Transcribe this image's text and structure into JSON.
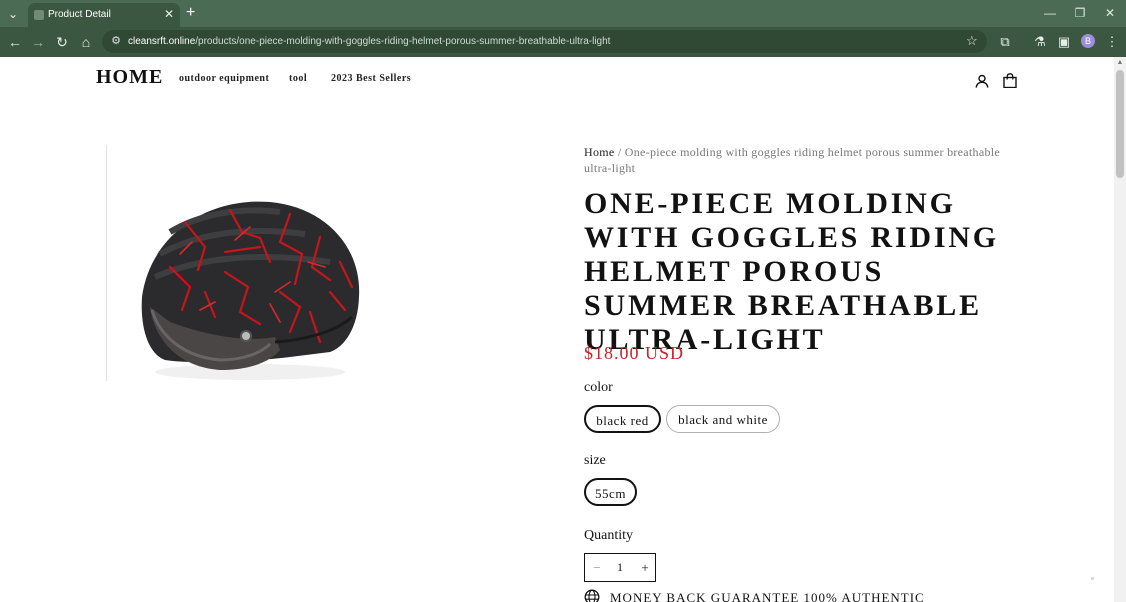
{
  "browser": {
    "tab_title": "Product Detail",
    "url_host": "cleansrft.online",
    "url_path": "/products/one-piece-molding-with-goggles-riding-helmet-porous-summer-breathable-ultra-light",
    "profile_initial": "B",
    "theme_color": "#4c6b55"
  },
  "header": {
    "logo": "HOME",
    "nav": [
      "outdoor equipment",
      "tool",
      "2023 Best Sellers"
    ],
    "icons": [
      "account-icon",
      "cart-icon"
    ]
  },
  "product": {
    "breadcrumb_home": "Home",
    "breadcrumb_sep": " / ",
    "breadcrumb_current": "One-piece molding with goggles riding helmet porous summer breathable ultra-light",
    "title": "ONE-PIECE MOLDING WITH GOGGLES RIDING HELMET POROUS SUMMER BREATHABLE ULTRA-LIGHT",
    "price": "$18.00 USD",
    "price_color": "#c8222a",
    "color_label": "color",
    "color_options": [
      "black red",
      "black and white"
    ],
    "color_selected": "black red",
    "size_label": "size",
    "size_options": [
      "55cm"
    ],
    "size_selected": "55cm",
    "quantity_label": "Quantity",
    "quantity_value": "1",
    "quantity_minus": "−",
    "quantity_plus": "+",
    "guarantee_text": "MONEY BACK GUARANTEE 100% AUTHENTIC"
  }
}
